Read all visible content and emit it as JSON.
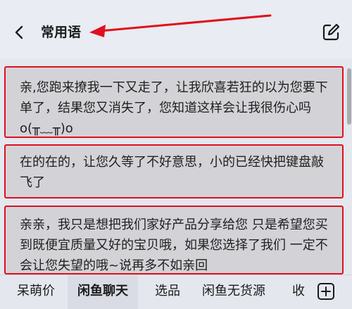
{
  "header": {
    "title": "常用语",
    "back_icon": "chevron-left-icon",
    "edit_icon": "edit-icon"
  },
  "phrases": [
    {
      "text": "亲,您跑来撩我一下又走了，让我欣喜若狂的以为您要下单了，结果您又消失了，您知道这样会让我很伤心吗o(╥﹏╥)o"
    },
    {
      "text": "在的在的，让您久等了不好意思，小的已经快把键盘敲飞了"
    },
    {
      "text": "亲亲，我只是想把我们家好产品分享给您 只是希望您买到既便宜质量又好的宝贝哦，如果您选择了我们 一定不会让您失望的哦~说再多不如亲回"
    }
  ],
  "tabs": [
    {
      "label": "呆萌价",
      "active": false
    },
    {
      "label": "闲鱼聊天",
      "active": true
    },
    {
      "label": "选品",
      "active": false
    },
    {
      "label": "闲鱼无货源",
      "active": false
    },
    {
      "label": "收",
      "active": false
    }
  ],
  "add_icon": "plus-square-icon",
  "colors": {
    "highlight_red": "#e0101e",
    "card_bg": "#d3d3d7",
    "page_bg": "#e4e7ee"
  }
}
